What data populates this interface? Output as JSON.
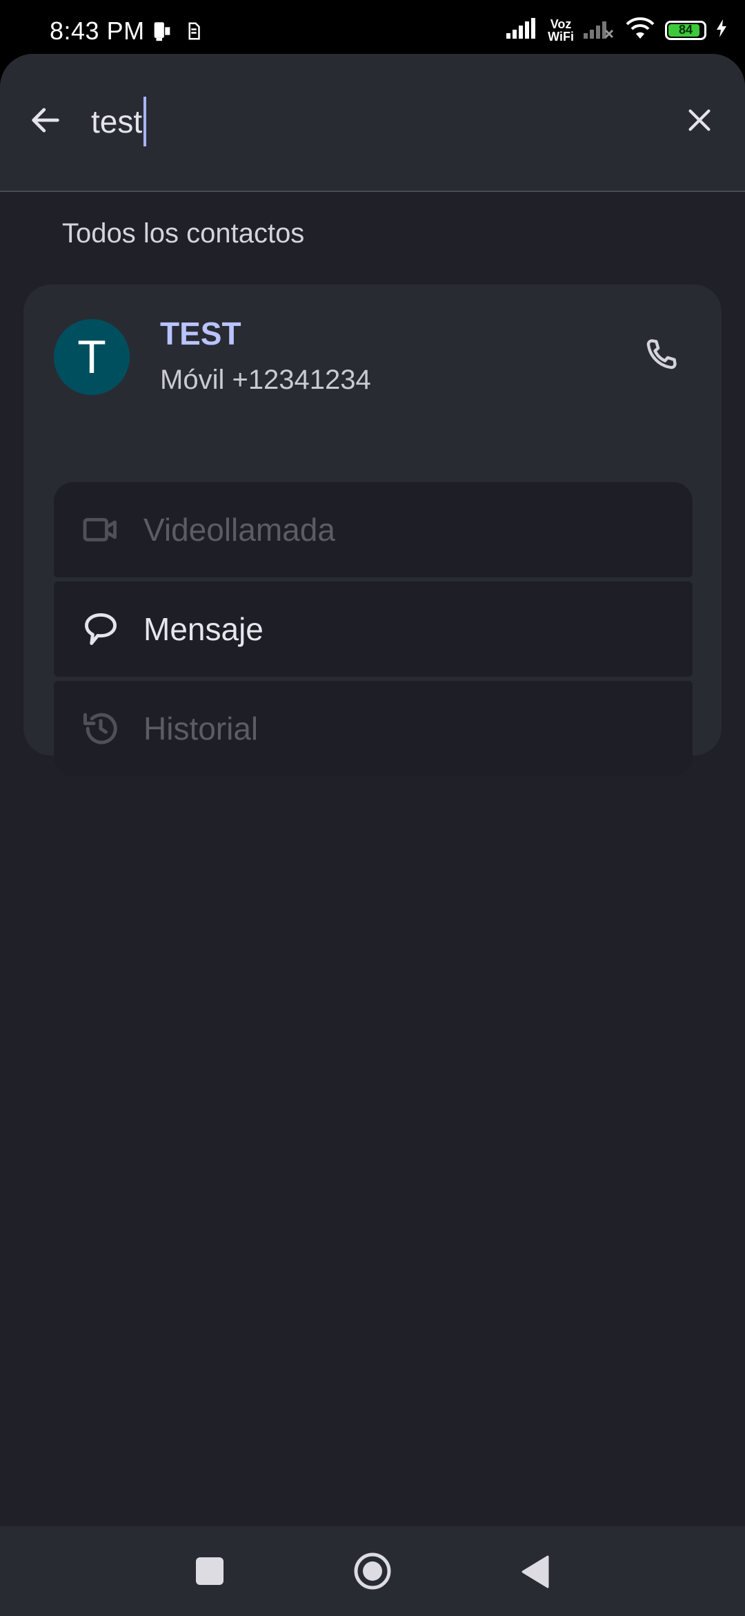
{
  "status_bar": {
    "time": "8:43 PM",
    "voz": "Voz",
    "wifi_label": "WiFi",
    "battery": "84"
  },
  "search": {
    "query": "test"
  },
  "section": {
    "title": "Todos los contactos"
  },
  "contact": {
    "initial": "T",
    "name": "TEST",
    "phone": "Móvil +12341234",
    "avatar_color": "#004f5f"
  },
  "actions": [
    {
      "label": "Videollamada",
      "icon": "video-icon",
      "enabled": false
    },
    {
      "label": "Mensaje",
      "icon": "message-icon",
      "enabled": true
    },
    {
      "label": "Historial",
      "icon": "history-icon",
      "enabled": false
    }
  ],
  "colors": {
    "background": "#1f2028",
    "surface": "#292b33",
    "accent": "#b9c3ff",
    "battery": "#3ec93a"
  }
}
